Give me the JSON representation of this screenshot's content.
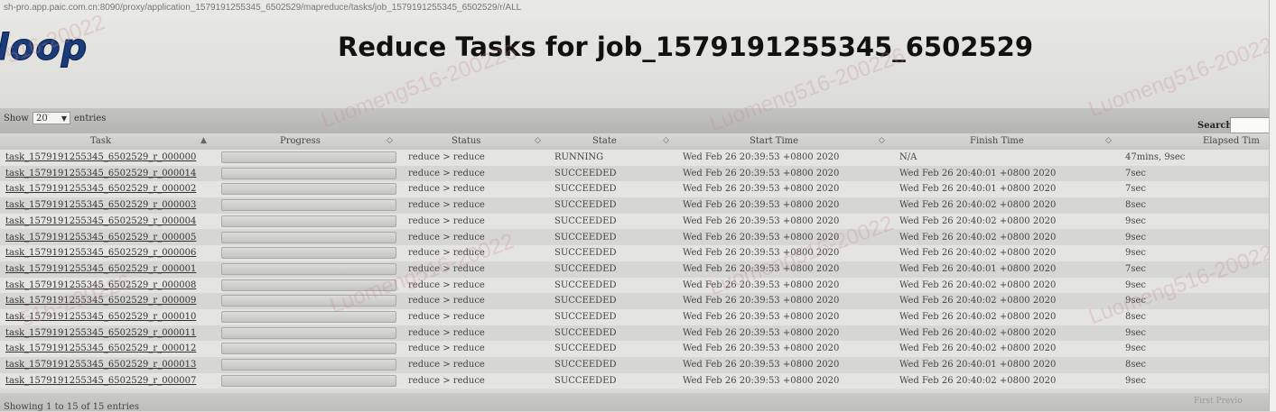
{
  "browser": {
    "url": "sh-pro.app.paic.com.cn:8090/proxy/application_1579191255345_6502529/mapreduce/tasks/job_1579191255345_6502529/r/ALL"
  },
  "header": {
    "logo_text": "loop",
    "title": "Reduce Tasks for job_1579191255345_6502529"
  },
  "controls": {
    "show_label": "Show",
    "show_value": "20",
    "entries_label": "entries",
    "search_label": "Search:"
  },
  "table": {
    "columns": [
      "Task",
      "Progress",
      "Status",
      "State",
      "Start Time",
      "Finish Time",
      "Elapsed Tim"
    ],
    "rows": [
      {
        "task": "task_1579191255345_6502529_r_000000",
        "status": "reduce > reduce",
        "state": "RUNNING",
        "start": "Wed Feb 26 20:39:53 +0800 2020",
        "finish": "N/A",
        "elapsed": "47mins, 9sec"
      },
      {
        "task": "task_1579191255345_6502529_r_000014",
        "status": "reduce > reduce",
        "state": "SUCCEEDED",
        "start": "Wed Feb 26 20:39:53 +0800 2020",
        "finish": "Wed Feb 26 20:40:01 +0800 2020",
        "elapsed": "7sec"
      },
      {
        "task": "task_1579191255345_6502529_r_000002",
        "status": "reduce > reduce",
        "state": "SUCCEEDED",
        "start": "Wed Feb 26 20:39:53 +0800 2020",
        "finish": "Wed Feb 26 20:40:01 +0800 2020",
        "elapsed": "7sec"
      },
      {
        "task": "task_1579191255345_6502529_r_000003",
        "status": "reduce > reduce",
        "state": "SUCCEEDED",
        "start": "Wed Feb 26 20:39:53 +0800 2020",
        "finish": "Wed Feb 26 20:40:02 +0800 2020",
        "elapsed": "8sec"
      },
      {
        "task": "task_1579191255345_6502529_r_000004",
        "status": "reduce > reduce",
        "state": "SUCCEEDED",
        "start": "Wed Feb 26 20:39:53 +0800 2020",
        "finish": "Wed Feb 26 20:40:02 +0800 2020",
        "elapsed": "9sec"
      },
      {
        "task": "task_1579191255345_6502529_r_000005",
        "status": "reduce > reduce",
        "state": "SUCCEEDED",
        "start": "Wed Feb 26 20:39:53 +0800 2020",
        "finish": "Wed Feb 26 20:40:02 +0800 2020",
        "elapsed": "9sec"
      },
      {
        "task": "task_1579191255345_6502529_r_000006",
        "status": "reduce > reduce",
        "state": "SUCCEEDED",
        "start": "Wed Feb 26 20:39:53 +0800 2020",
        "finish": "Wed Feb 26 20:40:02 +0800 2020",
        "elapsed": "9sec"
      },
      {
        "task": "task_1579191255345_6502529_r_000001",
        "status": "reduce > reduce",
        "state": "SUCCEEDED",
        "start": "Wed Feb 26 20:39:53 +0800 2020",
        "finish": "Wed Feb 26 20:40:01 +0800 2020",
        "elapsed": "7sec"
      },
      {
        "task": "task_1579191255345_6502529_r_000008",
        "status": "reduce > reduce",
        "state": "SUCCEEDED",
        "start": "Wed Feb 26 20:39:53 +0800 2020",
        "finish": "Wed Feb 26 20:40:02 +0800 2020",
        "elapsed": "9sec"
      },
      {
        "task": "task_1579191255345_6502529_r_000009",
        "status": "reduce > reduce",
        "state": "SUCCEEDED",
        "start": "Wed Feb 26 20:39:53 +0800 2020",
        "finish": "Wed Feb 26 20:40:02 +0800 2020",
        "elapsed": "9sec"
      },
      {
        "task": "task_1579191255345_6502529_r_000010",
        "status": "reduce > reduce",
        "state": "SUCCEEDED",
        "start": "Wed Feb 26 20:39:53 +0800 2020",
        "finish": "Wed Feb 26 20:40:02 +0800 2020",
        "elapsed": "8sec"
      },
      {
        "task": "task_1579191255345_6502529_r_000011",
        "status": "reduce > reduce",
        "state": "SUCCEEDED",
        "start": "Wed Feb 26 20:39:53 +0800 2020",
        "finish": "Wed Feb 26 20:40:02 +0800 2020",
        "elapsed": "9sec"
      },
      {
        "task": "task_1579191255345_6502529_r_000012",
        "status": "reduce > reduce",
        "state": "SUCCEEDED",
        "start": "Wed Feb 26 20:39:53 +0800 2020",
        "finish": "Wed Feb 26 20:40:02 +0800 2020",
        "elapsed": "9sec"
      },
      {
        "task": "task_1579191255345_6502529_r_000013",
        "status": "reduce > reduce",
        "state": "SUCCEEDED",
        "start": "Wed Feb 26 20:39:53 +0800 2020",
        "finish": "Wed Feb 26 20:40:01 +0800 2020",
        "elapsed": "8sec"
      },
      {
        "task": "task_1579191255345_6502529_r_000007",
        "status": "reduce > reduce",
        "state": "SUCCEEDED",
        "start": "Wed Feb 26 20:39:53 +0800 2020",
        "finish": "Wed Feb 26 20:40:02 +0800 2020",
        "elapsed": "9sec"
      }
    ]
  },
  "footer": {
    "info": "Showing 1 to 15 of 15 entries",
    "first": "First",
    "previous": "Previo"
  },
  "watermarks": [
    "516-20022",
    "Luomeng516-200226",
    "Luomeng516-200226",
    "Luomeng516-200226",
    "Luomeng516-20022",
    "Luomeng516-20022",
    "Luomeng516-200226",
    "516-200226"
  ]
}
